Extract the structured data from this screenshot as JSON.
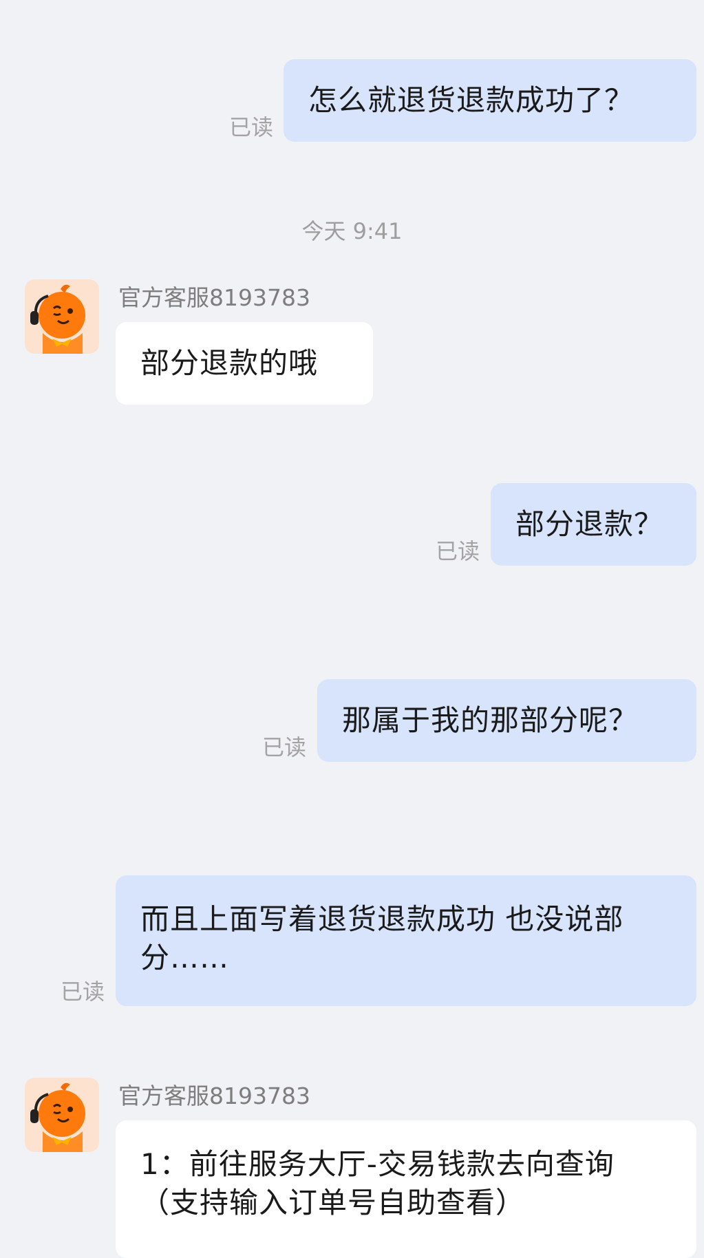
{
  "chat": {
    "read_label": "已读",
    "timestamp": "今天 9:41",
    "agent_name": "官方客服8193783",
    "messages": [
      {
        "from": "user",
        "text": "怎么就退货退款成功了？"
      },
      {
        "from": "agent",
        "text": "部分退款的哦"
      },
      {
        "from": "user",
        "text": "部分退款？"
      },
      {
        "from": "user",
        "text": "那属于我的那部分呢？"
      },
      {
        "from": "user",
        "text": "而且上面写着退货退款成功 也没说部分……"
      },
      {
        "from": "agent",
        "text": "1：前往服务大厅-交易钱款去向查询（支持输入订单号自助查看）"
      }
    ]
  },
  "icons": {
    "agent_avatar": "orange-customer-service-mascot-icon"
  },
  "colors": {
    "background": "#f1f2f6",
    "user_bubble": "#d8e4fc",
    "agent_bubble": "#ffffff",
    "avatar_orange": "#ff7a0d"
  }
}
